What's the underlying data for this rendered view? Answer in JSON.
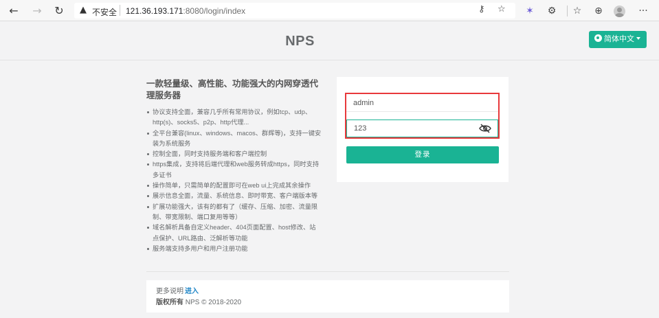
{
  "browser": {
    "back_icon": "←",
    "forward_icon": "→",
    "reload_icon": "↻",
    "warning_icon": "▲",
    "insecure_label": "不安全",
    "url_host": "121.36.193.171",
    "url_path": ":8080/login/index",
    "key_icon": "⚷",
    "tab_icon": "☆",
    "fav_icon": "✶",
    "ext_icon": "⚙",
    "favorites_icon": "☆",
    "collections_icon": "⊕",
    "menu_icon": "···"
  },
  "header": {
    "brand": "NPS",
    "language": "简体中文"
  },
  "intro": {
    "title": "一款轻量级、高性能、功能强大的内网穿透代理服务器",
    "features": [
      "协议支持全面，兼容几乎所有常用协议，例如tcp、udp、http(s)、socks5、p2p、http代理...",
      "全平台兼容(linux、windows、macos、群辉等)，支持一键安装为系统服务",
      "控制全面，同时支持服务端和客户端控制",
      "https集成，支持将后端代理和web服务转成https，同时支持多证书",
      "操作简单，只需简单的配置即可在web ui上完成其余操作",
      "展示信息全面，流量、系统信息、即时带宽、客户端版本等",
      "扩展功能强大，该有的都有了（缓存、压缩、加密、流量限制、带宽限制、端口复用等等）",
      "域名解析具备自定义header、404页面配置、host修改、站点保护、URL路由、泛解析等功能",
      "服务端支持多用户和用户注册功能"
    ]
  },
  "login": {
    "username_value": "admin",
    "password_value": "123",
    "submit_label": "登录"
  },
  "footer": {
    "more_label": "更多说明",
    "more_link": "进入",
    "copyright_strong": "版权所有",
    "copyright_text": " NPS © 2018-2020"
  },
  "colors": {
    "accent": "#1ab394",
    "highlight_frame": "#e8383b",
    "link": "#1c84c6"
  }
}
